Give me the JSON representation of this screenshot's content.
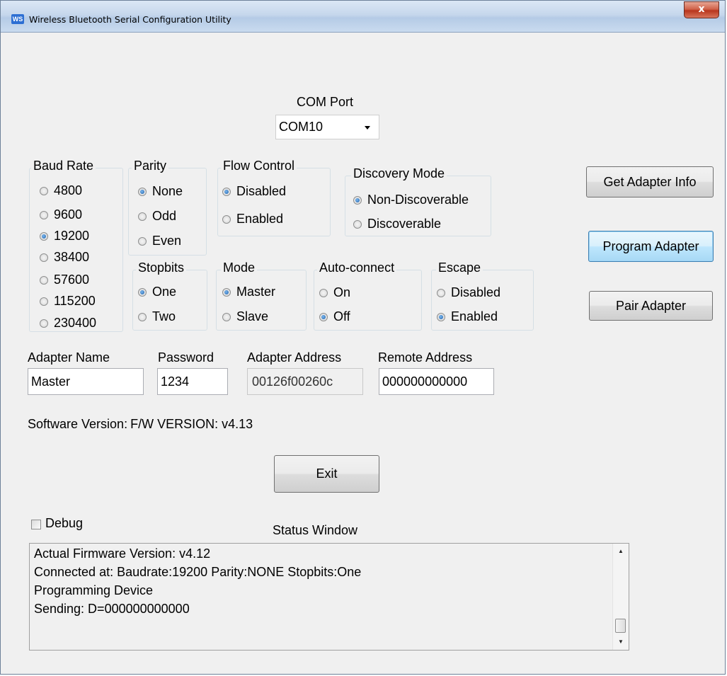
{
  "window": {
    "title": "Wireless Bluetooth Serial Configuration Utility",
    "icon": "app-logo-icon",
    "close_label": "x"
  },
  "com_port": {
    "label": "COM Port",
    "value": "COM10"
  },
  "baud_rate": {
    "title": "Baud Rate",
    "options": [
      "4800",
      "9600",
      "19200",
      "38400",
      "57600",
      "115200",
      "230400"
    ],
    "selected": "19200"
  },
  "parity": {
    "title": "Parity",
    "options": [
      "None",
      "Odd",
      "Even"
    ],
    "selected": "None"
  },
  "flow_control": {
    "title": "Flow Control",
    "options": [
      "Disabled",
      "Enabled"
    ],
    "selected": "Disabled"
  },
  "discovery_mode": {
    "title": "Discovery Mode",
    "options": [
      "Non-Discoverable",
      "Discoverable"
    ],
    "selected": "Non-Discoverable"
  },
  "stopbits": {
    "title": "Stopbits",
    "options": [
      "One",
      "Two"
    ],
    "selected": "One"
  },
  "mode": {
    "title": "Mode",
    "options": [
      "Master",
      "Slave"
    ],
    "selected": "Master"
  },
  "auto_connect": {
    "title": "Auto-connect",
    "options": [
      "On",
      "Off"
    ],
    "selected": "Off"
  },
  "escape": {
    "title": "Escape",
    "options": [
      "Disabled",
      "Enabled"
    ],
    "selected": "Enabled"
  },
  "buttons": {
    "get_info": "Get Adapter Info",
    "program": "Program Adapter",
    "pair": "Pair Adapter",
    "exit": "Exit"
  },
  "fields": {
    "adapter_name": {
      "label": "Adapter Name",
      "value": "Master"
    },
    "password": {
      "label": "Password",
      "value": "1234"
    },
    "adapter_address": {
      "label": "Adapter Address",
      "value": "00126f00260c"
    },
    "remote_address": {
      "label": "Remote Address",
      "value": "000000000000"
    }
  },
  "software_version": {
    "label": "Software Version:",
    "value": "F/W VERSION: v4.13"
  },
  "debug": {
    "label": "Debug",
    "checked": false
  },
  "status_window": {
    "label": "Status Window",
    "lines": [
      "Actual Firmware Version: v4.12",
      "Connected at: Baudrate:19200 Parity:NONE Stopbits:One",
      "Programming Device",
      "Sending: D=000000000000"
    ]
  }
}
